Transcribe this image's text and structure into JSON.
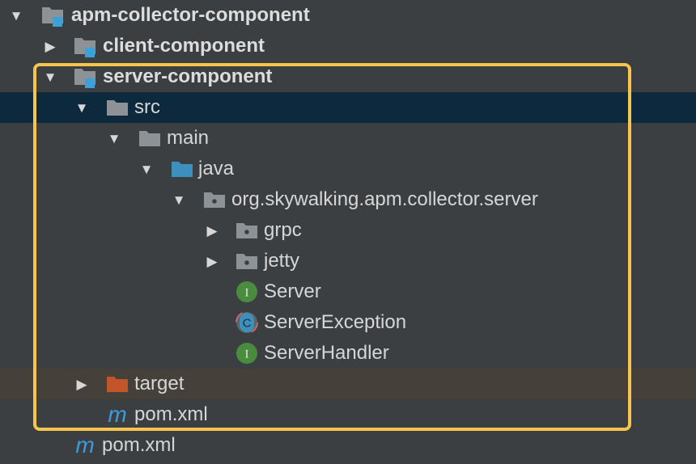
{
  "tree": {
    "nodes": {
      "root": {
        "label": "apm-collector-component",
        "icon": "module-folder-icon",
        "arrow": "expanded"
      },
      "client": {
        "label": "client-component",
        "icon": "module-folder-icon",
        "arrow": "collapsed"
      },
      "server": {
        "label": "server-component",
        "icon": "module-folder-icon",
        "arrow": "expanded"
      },
      "src": {
        "label": "src",
        "icon": "folder-icon",
        "arrow": "expanded"
      },
      "main": {
        "label": "main",
        "icon": "folder-icon",
        "arrow": "expanded"
      },
      "java": {
        "label": "java",
        "icon": "source-root-folder-icon",
        "arrow": "expanded"
      },
      "pkg": {
        "label": "org.skywalking.apm.collector.server",
        "icon": "package-icon",
        "arrow": "expanded"
      },
      "grpc": {
        "label": "grpc",
        "icon": "package-icon",
        "arrow": "collapsed"
      },
      "jetty": {
        "label": "jetty",
        "icon": "package-icon",
        "arrow": "collapsed"
      },
      "server_iface": {
        "label": "Server",
        "icon": "interface-icon",
        "badge": "I"
      },
      "server_exception": {
        "label": "ServerException",
        "icon": "class-icon",
        "badge": "C"
      },
      "server_handler": {
        "label": "ServerHandler",
        "icon": "interface-icon",
        "badge": "I"
      },
      "target": {
        "label": "target",
        "icon": "excluded-folder-icon",
        "arrow": "collapsed"
      },
      "pom_server": {
        "label": "pom.xml",
        "icon": "maven-icon",
        "badge": "m"
      },
      "pom_root": {
        "label": "pom.xml",
        "icon": "maven-icon",
        "badge": "m"
      }
    },
    "selected_node": "src",
    "highlight_color": "#f6c54b"
  },
  "colors": {
    "background": "#3c3f41",
    "selection": "#0d293e",
    "excluded_row": "#45413a",
    "folder": "#8d9296",
    "source_folder": "#3d8fbd",
    "module_badge": "#3ea0d8",
    "interface": "#4a8c3f",
    "class": "#3d8fbd",
    "excluded_folder": "#c2552a",
    "maven": "#3f9bd9"
  }
}
